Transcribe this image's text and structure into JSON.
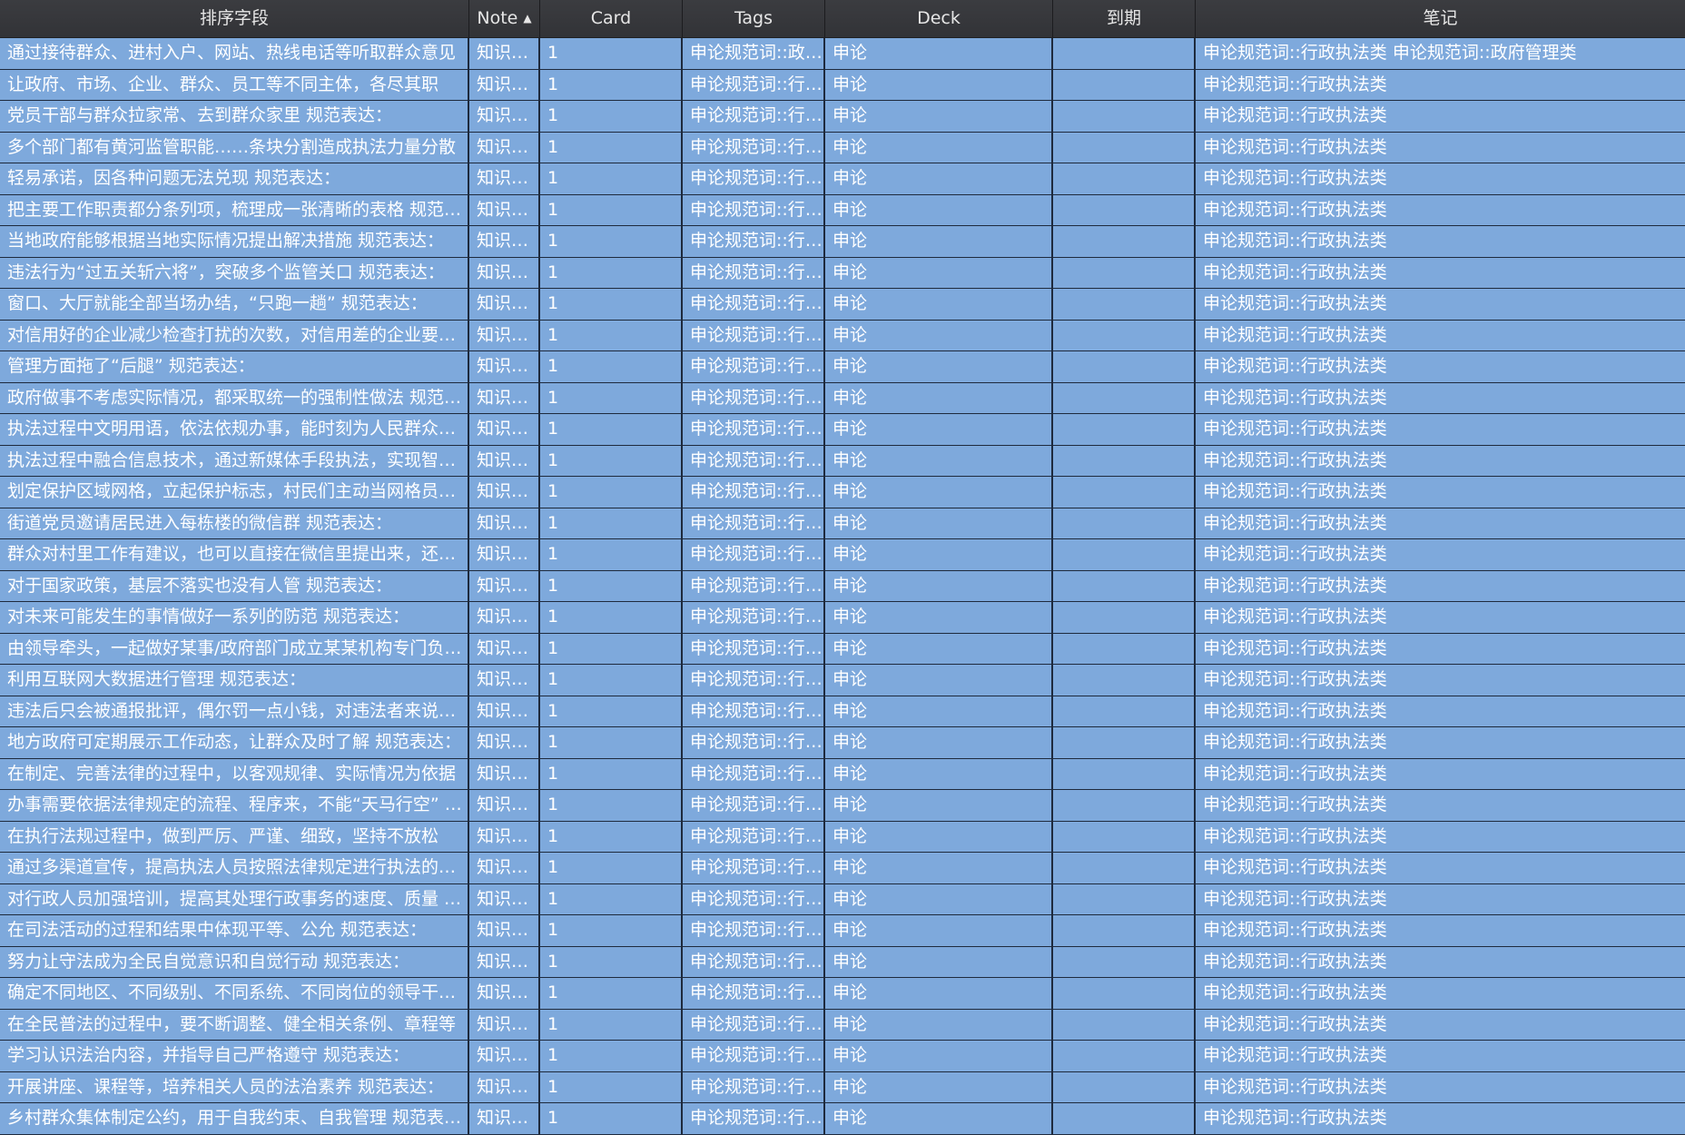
{
  "columns": [
    "排序字段",
    "Note",
    "Card",
    "Tags",
    "Deck",
    "到期",
    "笔记"
  ],
  "sort_indicator_icon": "triangle-up",
  "rows": [
    {
      "sort": "通过接待群众、进村入户、网站、热线电话等听取群众意见",
      "note": "知识…",
      "card": "1",
      "tags": "申论规范词::政…",
      "deck": "申论",
      "due": "",
      "notes": "申论规范词::行政执法类 申论规范词::政府管理类"
    },
    {
      "sort": "让政府、市场、企业、群众、员工等不同主体，各尽其职",
      "note": "知识…",
      "card": "1",
      "tags": "申论规范词::行…",
      "deck": "申论",
      "due": "",
      "notes": "申论规范词::行政执法类"
    },
    {
      "sort": "党员干部与群众拉家常、去到群众家里 规范表达：",
      "note": "知识…",
      "card": "1",
      "tags": "申论规范词::行…",
      "deck": "申论",
      "due": "",
      "notes": "申论规范词::行政执法类"
    },
    {
      "sort": "多个部门都有黄河监管职能……条块分割造成执法力量分散",
      "note": "知识…",
      "card": "1",
      "tags": "申论规范词::行…",
      "deck": "申论",
      "due": "",
      "notes": "申论规范词::行政执法类"
    },
    {
      "sort": "轻易承诺，因各种问题无法兑现 规范表达：",
      "note": "知识…",
      "card": "1",
      "tags": "申论规范词::行…",
      "deck": "申论",
      "due": "",
      "notes": "申论规范词::行政执法类"
    },
    {
      "sort": "把主要工作职责都分条列项，梳理成一张清晰的表格 规范表达：",
      "note": "知识…",
      "card": "1",
      "tags": "申论规范词::行…",
      "deck": "申论",
      "due": "",
      "notes": "申论规范词::行政执法类"
    },
    {
      "sort": "当地政府能够根据当地实际情况提出解决措施 规范表达：",
      "note": "知识…",
      "card": "1",
      "tags": "申论规范词::行…",
      "deck": "申论",
      "due": "",
      "notes": "申论规范词::行政执法类"
    },
    {
      "sort": "违法行为“过五关斩六将”，突破多个监管关口 规范表达：",
      "note": "知识…",
      "card": "1",
      "tags": "申论规范词::行…",
      "deck": "申论",
      "due": "",
      "notes": "申论规范词::行政执法类"
    },
    {
      "sort": "窗口、大厅就能全部当场办结，“只跑一趟” 规范表达：",
      "note": "知识…",
      "card": "1",
      "tags": "申论规范词::行…",
      "deck": "申论",
      "due": "",
      "notes": "申论规范词::行政执法类"
    },
    {
      "sort": "对信用好的企业减少检查打扰的次数，对信用差的企业要加大检查",
      "note": "知识…",
      "card": "1",
      "tags": "申论规范词::行…",
      "deck": "申论",
      "due": "",
      "notes": "申论规范词::行政执法类"
    },
    {
      "sort": "管理方面拖了“后腿” 规范表达：",
      "note": "知识…",
      "card": "1",
      "tags": "申论规范词::行…",
      "deck": "申论",
      "due": "",
      "notes": "申论规范词::行政执法类"
    },
    {
      "sort": "政府做事不考虑实际情况，都采取统一的强制性做法 规范表达：",
      "note": "知识…",
      "card": "1",
      "tags": "申论规范词::行…",
      "deck": "申论",
      "due": "",
      "notes": "申论规范词::行政执法类"
    },
    {
      "sort": "执法过程中文明用语，依法依规办事，能时刻为人民群众着想",
      "note": "知识…",
      "card": "1",
      "tags": "申论规范词::行…",
      "deck": "申论",
      "due": "",
      "notes": "申论规范词::行政执法类"
    },
    {
      "sort": "执法过程中融合信息技术，通过新媒体手段执法，实现智能化",
      "note": "知识…",
      "card": "1",
      "tags": "申论规范词::行…",
      "deck": "申论",
      "due": "",
      "notes": "申论规范词::行政执法类"
    },
    {
      "sort": "划定保护区域网格，立起保护标志，村民们主动当网格员参与",
      "note": "知识…",
      "card": "1",
      "tags": "申论规范词::行…",
      "deck": "申论",
      "due": "",
      "notes": "申论规范词::行政执法类"
    },
    {
      "sort": "街道党员邀请居民进入每栋楼的微信群 规范表达：",
      "note": "知识…",
      "card": "1",
      "tags": "申论规范词::行…",
      "deck": "申论",
      "due": "",
      "notes": "申论规范词::行政执法类"
    },
    {
      "sort": "群众对村里工作有建议，也可以直接在微信里提出来，还能及时反馈",
      "note": "知识…",
      "card": "1",
      "tags": "申论规范词::行…",
      "deck": "申论",
      "due": "",
      "notes": "申论规范词::行政执法类"
    },
    {
      "sort": "对于国家政策，基层不落实也没有人管 规范表达：",
      "note": "知识…",
      "card": "1",
      "tags": "申论规范词::行…",
      "deck": "申论",
      "due": "",
      "notes": "申论规范词::行政执法类"
    },
    {
      "sort": "对未来可能发生的事情做好一系列的防范 规范表达：",
      "note": "知识…",
      "card": "1",
      "tags": "申论规范词::行…",
      "deck": "申论",
      "due": "",
      "notes": "申论规范词::行政执法类"
    },
    {
      "sort": "由领导牵头，一起做好某事/政府部门成立某某机构专门负责某事",
      "note": "知识…",
      "card": "1",
      "tags": "申论规范词::行…",
      "deck": "申论",
      "due": "",
      "notes": "申论规范词::行政执法类"
    },
    {
      "sort": "利用互联网大数据进行管理 规范表达：",
      "note": "知识…",
      "card": "1",
      "tags": "申论规范词::行…",
      "deck": "申论",
      "due": "",
      "notes": "申论规范词::行政执法类"
    },
    {
      "sort": "违法后只会被通报批评，偶尔罚一点小钱，对违法者来说不痛不痒",
      "note": "知识…",
      "card": "1",
      "tags": "申论规范词::行…",
      "deck": "申论",
      "due": "",
      "notes": "申论规范词::行政执法类"
    },
    {
      "sort": "地方政府可定期展示工作动态，让群众及时了解 规范表达：",
      "note": "知识…",
      "card": "1",
      "tags": "申论规范词::行…",
      "deck": "申论",
      "due": "",
      "notes": "申论规范词::行政执法类"
    },
    {
      "sort": "在制定、完善法律的过程中，以客观规律、实际情况为依据",
      "note": "知识…",
      "card": "1",
      "tags": "申论规范词::行…",
      "deck": "申论",
      "due": "",
      "notes": "申论规范词::行政执法类"
    },
    {
      "sort": "办事需要依据法律规定的流程、程序来，不能“天马行空” 规范表达：",
      "note": "知识…",
      "card": "1",
      "tags": "申论规范词::行…",
      "deck": "申论",
      "due": "",
      "notes": "申论规范词::行政执法类"
    },
    {
      "sort": "在执行法规过程中，做到严厉、严谨、细致，坚持不放松",
      "note": "知识…",
      "card": "1",
      "tags": "申论规范词::行…",
      "deck": "申论",
      "due": "",
      "notes": "申论规范词::行政执法类"
    },
    {
      "sort": "通过多渠道宣传，提高执法人员按照法律规定进行执法的意识",
      "note": "知识…",
      "card": "1",
      "tags": "申论规范词::行…",
      "deck": "申论",
      "due": "",
      "notes": "申论规范词::行政执法类"
    },
    {
      "sort": "对行政人员加强培训，提高其处理行政事务的速度、质量 规范表达：",
      "note": "知识…",
      "card": "1",
      "tags": "申论规范词::行…",
      "deck": "申论",
      "due": "",
      "notes": "申论规范词::行政执法类"
    },
    {
      "sort": "在司法活动的过程和结果中体现平等、公允 规范表达：",
      "note": "知识…",
      "card": "1",
      "tags": "申论规范词::行…",
      "deck": "申论",
      "due": "",
      "notes": "申论规范词::行政执法类"
    },
    {
      "sort": "努力让守法成为全民自觉意识和自觉行动 规范表达：",
      "note": "知识…",
      "card": "1",
      "tags": "申论规范词::行…",
      "deck": "申论",
      "due": "",
      "notes": "申论规范词::行政执法类"
    },
    {
      "sort": "确定不同地区、不同级别、不同系统、不同岗位的领导干部职责",
      "note": "知识…",
      "card": "1",
      "tags": "申论规范词::行…",
      "deck": "申论",
      "due": "",
      "notes": "申论规范词::行政执法类"
    },
    {
      "sort": "在全民普法的过程中，要不断调整、健全相关条例、章程等",
      "note": "知识…",
      "card": "1",
      "tags": "申论规范词::行…",
      "deck": "申论",
      "due": "",
      "notes": "申论规范词::行政执法类"
    },
    {
      "sort": "学习认识法治内容，并指导自己严格遵守 规范表达：",
      "note": "知识…",
      "card": "1",
      "tags": "申论规范词::行…",
      "deck": "申论",
      "due": "",
      "notes": "申论规范词::行政执法类"
    },
    {
      "sort": "开展讲座、课程等，培养相关人员的法治素养 规范表达：",
      "note": "知识…",
      "card": "1",
      "tags": "申论规范词::行…",
      "deck": "申论",
      "due": "",
      "notes": "申论规范词::行政执法类"
    },
    {
      "sort": "乡村群众集体制定公约，用于自我约束、自我管理 规范表达：",
      "note": "知识…",
      "card": "1",
      "tags": "申论规范词::行…",
      "deck": "申论",
      "due": "",
      "notes": "申论规范词::行政执法类"
    }
  ]
}
